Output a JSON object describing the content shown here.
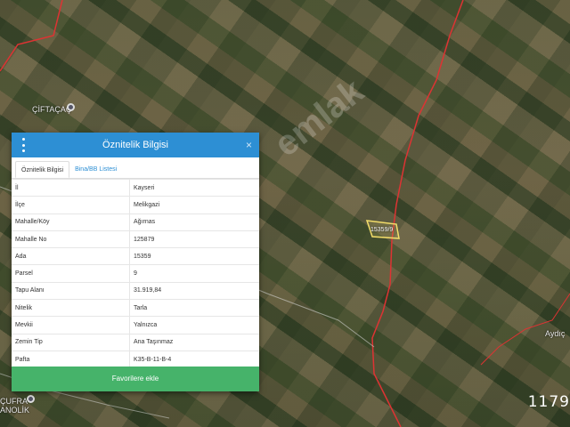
{
  "map": {
    "labels": {
      "village_top": "ÇİFTAÇAÇ",
      "village_bottom": "ÇUFRA",
      "village_bottom2": "ANOLİK",
      "village_right": "Aydıç",
      "parcel_label": "15359/9",
      "scale_text": "1179"
    },
    "watermark": "emlak"
  },
  "panel": {
    "title": "Öznitelik Bilgisi",
    "menu_icon": "kebab-menu-icon",
    "close_icon": "close-icon",
    "close_glyph": "×",
    "tabs": [
      "Öznitelik Bilgisi",
      "Bina/BB Listesi"
    ],
    "rows": [
      {
        "key": "İl",
        "value": "Kayseri"
      },
      {
        "key": "İlçe",
        "value": "Melikgazi"
      },
      {
        "key": "Mahalle/Köy",
        "value": "Ağırnas"
      },
      {
        "key": "Mahalle No",
        "value": "125879"
      },
      {
        "key": "Ada",
        "value": "15359"
      },
      {
        "key": "Parsel",
        "value": "9"
      },
      {
        "key": "Tapu Alanı",
        "value": "31.919,84"
      },
      {
        "key": "Nitelik",
        "value": "Tarla"
      },
      {
        "key": "Mevkii",
        "value": "Yalnızca"
      },
      {
        "key": "Zemin Tip",
        "value": "Ana Taşınmaz"
      },
      {
        "key": "Pafta",
        "value": "K35-B-11-B-4"
      }
    ],
    "favorite_button": "Favorilere ekle",
    "colors": {
      "header": "#2d8fd4",
      "button": "#46b36a"
    }
  }
}
